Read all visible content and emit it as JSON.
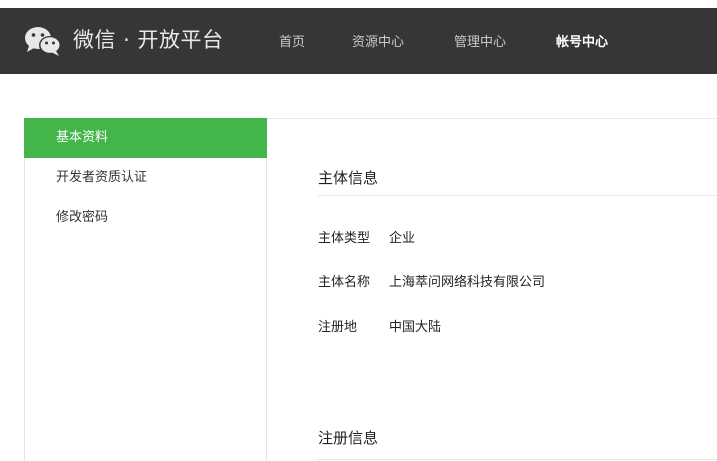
{
  "header": {
    "logo_icon": "wechat-logo-icon",
    "logo_text": "微信 · 开放平台",
    "nav": [
      {
        "label": "首页",
        "active": false
      },
      {
        "label": "资源中心",
        "active": false
      },
      {
        "label": "管理中心",
        "active": false
      },
      {
        "label": "帐号中心",
        "active": true
      }
    ]
  },
  "sidebar": {
    "items": [
      {
        "label": "基本资料",
        "active": true
      },
      {
        "label": "开发者资质认证",
        "active": false
      },
      {
        "label": "修改密码",
        "active": false
      }
    ]
  },
  "main": {
    "subject_section": {
      "title": "主体信息",
      "fields": [
        {
          "label": "主体类型",
          "value": "企业"
        },
        {
          "label": "主体名称",
          "value": "上海萃问网络科技有限公司"
        },
        {
          "label": "注册地",
          "value": "中国大陆"
        }
      ]
    },
    "register_section": {
      "title": "注册信息"
    }
  },
  "colors": {
    "header_bg": "#363636",
    "accent_green": "#44b549"
  }
}
